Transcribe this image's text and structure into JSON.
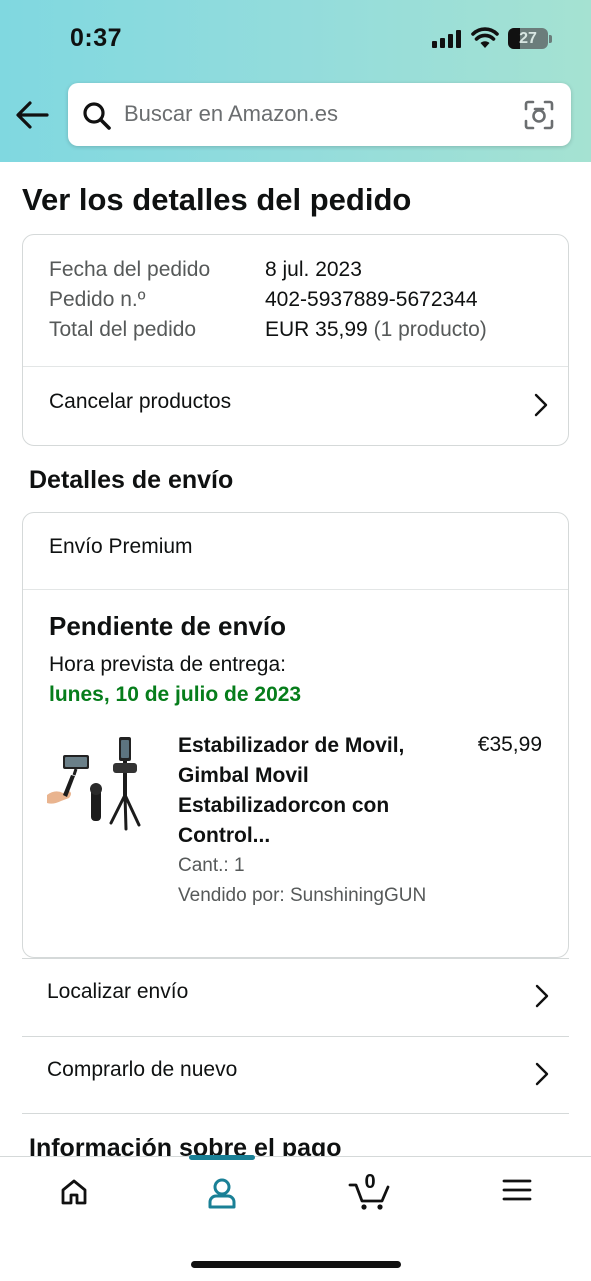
{
  "status_bar": {
    "time": "0:37",
    "battery_level": "27"
  },
  "search": {
    "placeholder": "Buscar en Amazon.es"
  },
  "page": {
    "title": "Ver los detalles del pedido"
  },
  "order_summary": {
    "rows": [
      {
        "label": "Fecha del pedido",
        "value": "8 jul. 2023"
      },
      {
        "label": "Pedido n.º",
        "value": "402-5937889-5672344"
      },
      {
        "label": "Total del pedido",
        "value": "EUR 35,99",
        "extra": "(1 producto)"
      }
    ],
    "cancel_label": "Cancelar productos"
  },
  "shipping": {
    "section_title": "Detalles de envío",
    "method": "Envío Premium",
    "status": "Pendiente de envío",
    "eta_label": "Hora prevista de entrega:",
    "eta_date": "lunes, 10 de julio de 2023",
    "product": {
      "title": "Estabilizador de Movil, Gimbal Movil Estabilizadorcon con Control...",
      "price": "€35,99",
      "qty": "Cant.: 1",
      "seller": "Vendido por: SunshiningGUN"
    }
  },
  "actions": {
    "track_label": "Localizar envío",
    "buy_again_label": "Comprarlo de nuevo"
  },
  "payment": {
    "section_title": "Información sobre el pago"
  },
  "tabbar": {
    "tabs": [
      {
        "icon": "home-icon"
      },
      {
        "icon": "user-icon",
        "active": true
      },
      {
        "icon": "cart-icon",
        "count": "0"
      },
      {
        "icon": "menu-icon"
      }
    ],
    "accent_color": "#1a8096"
  },
  "colors": {
    "delivery_green": "#067d1b",
    "header_gradient_start": "#80d8e0",
    "header_gradient_end": "#a5e2d2"
  }
}
